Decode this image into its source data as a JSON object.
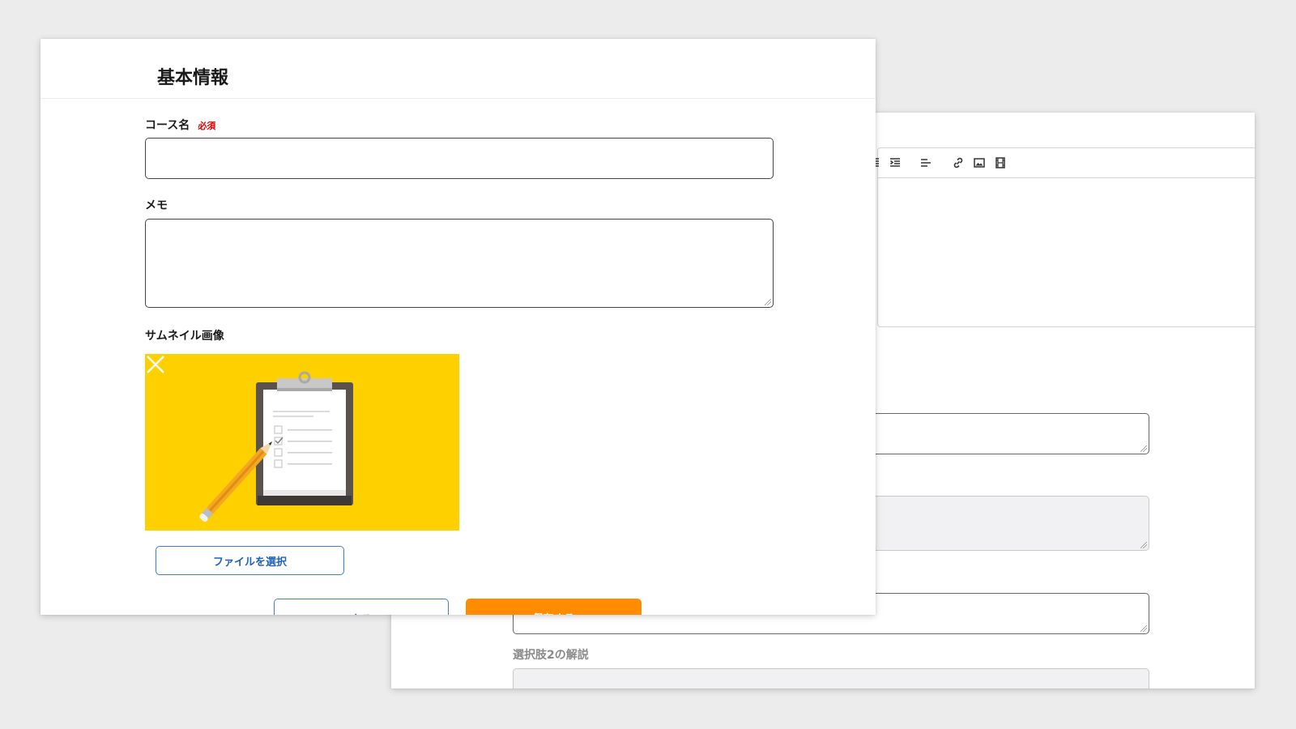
{
  "front": {
    "section_title": "基本情報",
    "course_name_label": "コース名",
    "required_badge": "必須",
    "memo_label": "メモ",
    "thumbnail_label": "サムネイル画像",
    "file_button": "ファイルを選択",
    "back_button": "戻る",
    "save_button": "保存する"
  },
  "back": {
    "option2_explanation_label": "選択肢2の解説"
  },
  "colors": {
    "accent_orange": "#ff8c00",
    "accent_blue": "#1e63b4",
    "thumbnail_bg": "#ffd000",
    "required_red": "#e00000"
  },
  "icons": [
    "outdent-icon",
    "indent-icon",
    "align-icon",
    "link-icon",
    "image-icon",
    "video-icon",
    "close-icon"
  ]
}
